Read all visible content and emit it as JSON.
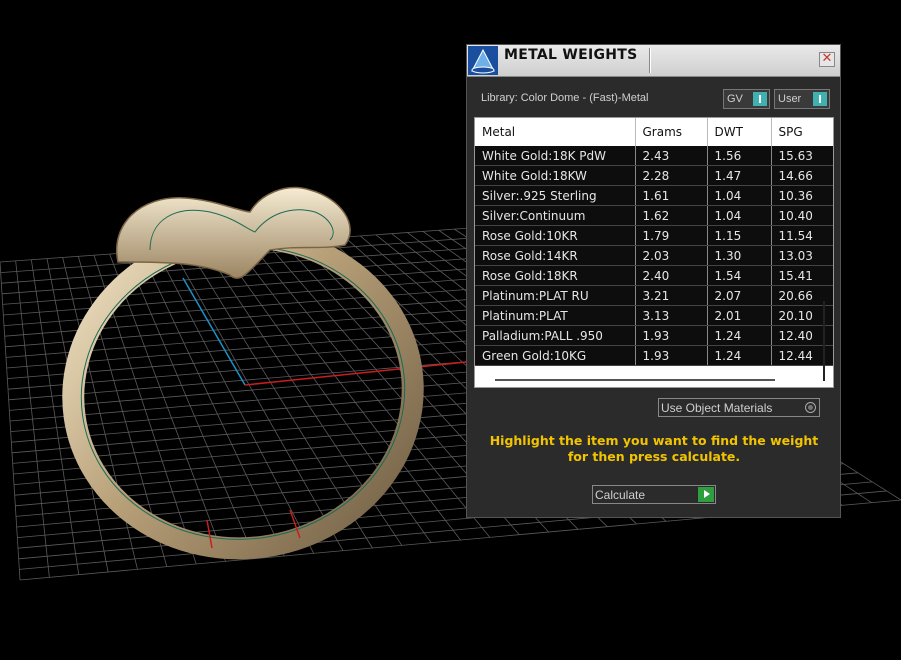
{
  "panel": {
    "title": "METAL WEIGHTS",
    "close_glyph": "✕",
    "library_label": "Library: Color Dome - (Fast)-Metal",
    "unit_buttons": {
      "gv": "GV",
      "user": "User"
    },
    "table": {
      "columns": [
        "Metal",
        "Grams",
        "DWT",
        "SPG"
      ],
      "rows": [
        [
          "White Gold:18K PdW",
          "2.43",
          "1.56",
          "15.63"
        ],
        [
          "White Gold:18KW",
          "2.28",
          "1.47",
          "14.66"
        ],
        [
          "Silver:.925 Sterling",
          "1.61",
          "1.04",
          "10.36"
        ],
        [
          "Silver:Continuum",
          "1.62",
          "1.04",
          "10.40"
        ],
        [
          "Rose Gold:10KR",
          "1.79",
          "1.15",
          "11.54"
        ],
        [
          "Rose Gold:14KR",
          "2.03",
          "1.30",
          "13.03"
        ],
        [
          "Rose Gold:18KR",
          "2.40",
          "1.54",
          "15.41"
        ],
        [
          "Platinum:PLAT RU",
          "3.21",
          "2.07",
          "20.66"
        ],
        [
          "Platinum:PLAT",
          "3.13",
          "2.01",
          "20.10"
        ],
        [
          "Palladium:PALL .950",
          "1.93",
          "1.24",
          "12.40"
        ],
        [
          "Green Gold:10KG",
          "1.93",
          "1.24",
          "12.44"
        ]
      ]
    },
    "use_object_materials_label": "Use Object Materials",
    "instruction": "Highlight the item you want to find the weight for then press calculate.",
    "calculate_label": "Calculate"
  },
  "colors": {
    "instruction_text": "#f2c400",
    "accent_teal": "#41b0b0",
    "play_green": "#2e9e3e",
    "ring_gold": "#c8b48e"
  }
}
